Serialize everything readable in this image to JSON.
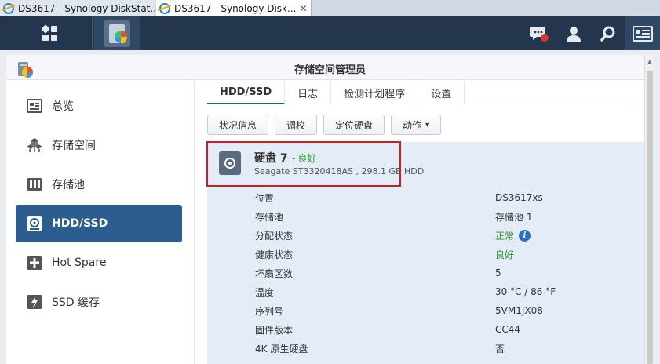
{
  "browser": {
    "tabs": [
      {
        "title": "DS3617 - Synology DiskStat..."
      },
      {
        "title": "DS3617 - Synology Disk..."
      }
    ],
    "close_label": "✕"
  },
  "window": {
    "title": "存储空间管理员"
  },
  "sidebar": {
    "items": [
      {
        "label": "总览",
        "icon": "overview-icon"
      },
      {
        "label": "存储空间",
        "icon": "volume-icon"
      },
      {
        "label": "存储池",
        "icon": "storage-pool-icon"
      },
      {
        "label": "HDD/SSD",
        "icon": "hdd-icon",
        "active": true
      },
      {
        "label": "Hot Spare",
        "icon": "hot-spare-icon"
      },
      {
        "label": "SSD 缓存",
        "icon": "ssd-cache-icon"
      }
    ]
  },
  "tabs": [
    {
      "label": "HDD/SSD",
      "active": true
    },
    {
      "label": "日志"
    },
    {
      "label": "检测计划程序"
    },
    {
      "label": "设置"
    }
  ],
  "toolbar": {
    "status_info": "状况信息",
    "calibrate": "调校",
    "locate_disk": "定位硬盘",
    "action": "动作",
    "action_caret": "▾"
  },
  "disk": {
    "name": "硬盘 7",
    "dash": "-",
    "status": "良好",
    "model": "Seagate ST3320418AS , 298.1 GB HDD",
    "properties": [
      {
        "key": "位置",
        "value": "DS3617xs"
      },
      {
        "key": "存储池",
        "value": "存储池 1"
      },
      {
        "key": "分配状态",
        "value": "正常",
        "ok": true,
        "info": true
      },
      {
        "key": "健康状态",
        "value": "良好",
        "ok": true
      },
      {
        "key": "坏扇区数",
        "value": "5"
      },
      {
        "key": "温度",
        "value": "30 °C / 86 °F"
      },
      {
        "key": "序列号",
        "value": "5VM1JX08"
      },
      {
        "key": "固件版本",
        "value": "CC44"
      },
      {
        "key": "4K 原生硬盘",
        "value": "否"
      }
    ],
    "info_glyph": "i"
  },
  "colors": {
    "topbar": "#23364d",
    "active_item": "#2b5e8e",
    "detail_bg": "#e4edf7",
    "ok_green": "#2a9a2a",
    "highlight_red": "#cc2020"
  }
}
